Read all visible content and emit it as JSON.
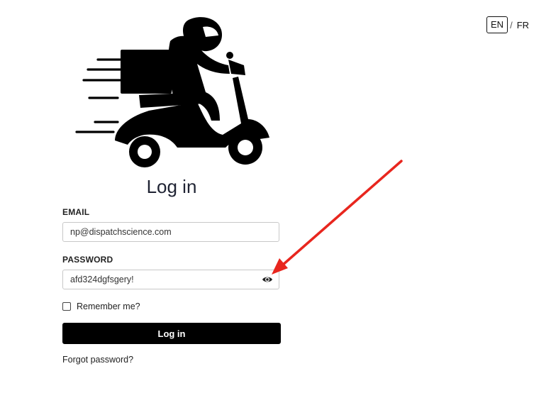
{
  "language": {
    "options": [
      "EN",
      "FR"
    ],
    "selected": "EN",
    "separator": "/"
  },
  "logo": {
    "icon": "delivery-scooter-icon"
  },
  "login": {
    "title": "Log in",
    "email_label": "EMAIL",
    "email_value": "np@dispatchscience.com",
    "password_label": "PASSWORD",
    "password_value": "afd324dgfsgery!",
    "show_password_icon": "eye-icon",
    "remember_label": "Remember me?",
    "remember_checked": false,
    "submit_label": "Log in",
    "forgot_label": "Forgot password?"
  },
  "annotation": {
    "arrow_color": "#e8261e"
  },
  "colors": {
    "button_bg": "#000000",
    "button_text": "#ffffff",
    "title": "#1f2333"
  }
}
